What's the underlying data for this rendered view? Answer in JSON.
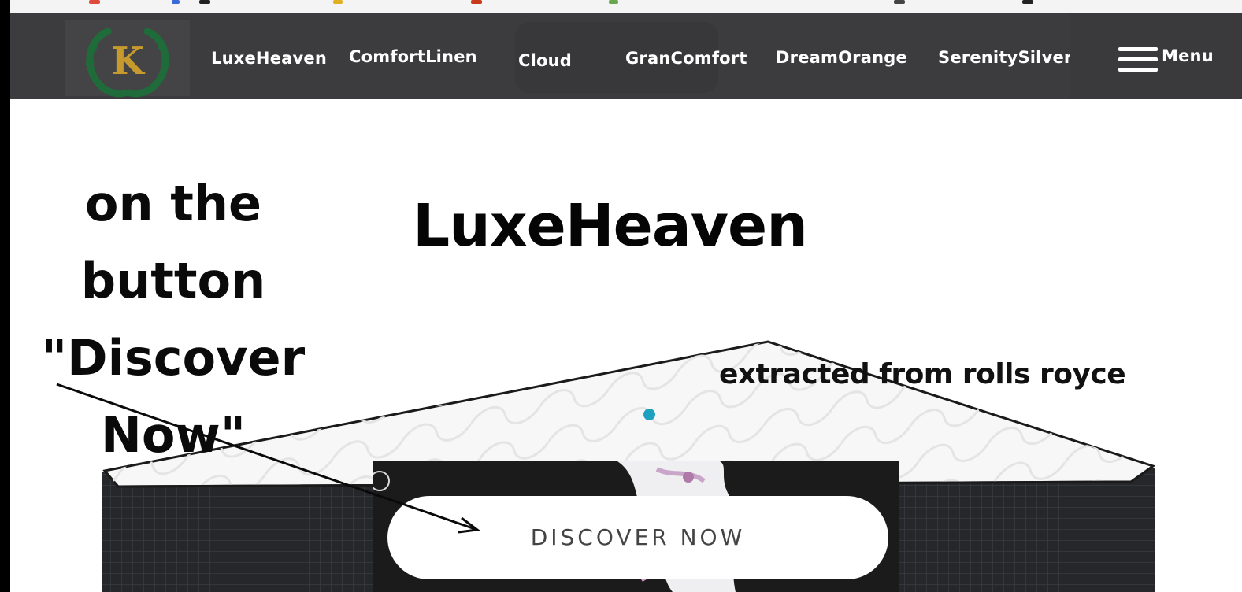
{
  "logo": {
    "letter": "K",
    "icon": "laurel-wreath-logo-icon"
  },
  "nav": {
    "items": [
      {
        "label": "LuxeHeaven"
      },
      {
        "label": "ComfortLinen"
      },
      {
        "label": "Cloud"
      },
      {
        "label": "GranComfort"
      },
      {
        "label": "DreamOrange"
      },
      {
        "label": "SerenitySilver"
      }
    ],
    "menu_label": "Menu",
    "menu_icon": "hamburger-menu-icon"
  },
  "annotation": {
    "lines": [
      "on the",
      "button",
      "\"Discover",
      "Now\""
    ]
  },
  "hero": {
    "title": "LuxeHeaven",
    "caption": "extracted from rolls royce"
  },
  "promo": {
    "button_label": "DISCOVER NOW"
  },
  "colors": {
    "navbar_bg": "#3c3c3f",
    "logo_gold": "#c79a2e",
    "logo_green": "#1f6b3a",
    "carousel_dot": "#1ea0c0",
    "mattress_dark": "#26272b"
  }
}
